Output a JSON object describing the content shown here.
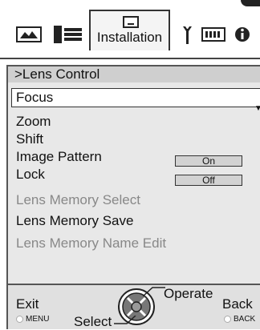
{
  "tabs": {
    "active_label": "Installation",
    "items": [
      {
        "icon": "picture-icon"
      },
      {
        "icon": "signal-input-icon"
      },
      {
        "icon": "monitor-icon"
      },
      {
        "icon": "wrench-icon"
      },
      {
        "icon": "keyboard-icon"
      },
      {
        "icon": "info-icon"
      }
    ]
  },
  "section": {
    "title": ">Lens Control"
  },
  "menu": {
    "focus": "Focus",
    "zoom": "Zoom",
    "shift": "Shift",
    "image_pattern": "Image Pattern",
    "image_pattern_value": "On",
    "lock": "Lock",
    "lock_value": "Off",
    "lens_memory_select": "Lens Memory Select",
    "lens_memory_save": "Lens Memory Save",
    "lens_memory_name_edit": "Lens Memory Name Edit"
  },
  "footer": {
    "exit_label": "Exit",
    "exit_key": "MENU",
    "select_label": "Select",
    "operate_label": "Operate",
    "back_label": "Back",
    "back_key": "BACK"
  }
}
